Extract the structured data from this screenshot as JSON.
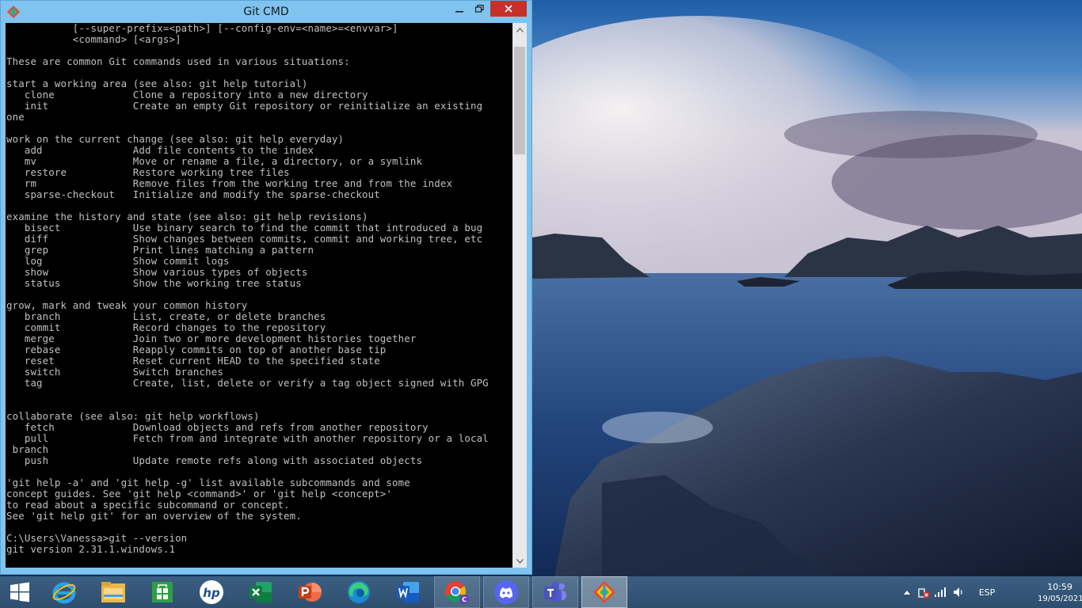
{
  "window": {
    "title": "Git CMD",
    "console_lines": [
      "           [--super-prefix=<path>] [--config-env=<name>=<envvar>]",
      "           <command> [<args>]",
      "",
      "These are common Git commands used in various situations:",
      "",
      "start a working area (see also: git help tutorial)",
      "   clone             Clone a repository into a new directory",
      "   init              Create an empty Git repository or reinitialize an existing",
      "one",
      "",
      "work on the current change (see also: git help everyday)",
      "   add               Add file contents to the index",
      "   mv                Move or rename a file, a directory, or a symlink",
      "   restore           Restore working tree files",
      "   rm                Remove files from the working tree and from the index",
      "   sparse-checkout   Initialize and modify the sparse-checkout",
      "",
      "examine the history and state (see also: git help revisions)",
      "   bisect            Use binary search to find the commit that introduced a bug",
      "   diff              Show changes between commits, commit and working tree, etc",
      "   grep              Print lines matching a pattern",
      "   log               Show commit logs",
      "   show              Show various types of objects",
      "   status            Show the working tree status",
      "",
      "grow, mark and tweak your common history",
      "   branch            List, create, or delete branches",
      "   commit            Record changes to the repository",
      "   merge             Join two or more development histories together",
      "   rebase            Reapply commits on top of another base tip",
      "   reset             Reset current HEAD to the specified state",
      "   switch            Switch branches",
      "   tag               Create, list, delete or verify a tag object signed with GPG",
      "",
      "",
      "collaborate (see also: git help workflows)",
      "   fetch             Download objects and refs from another repository",
      "   pull              Fetch from and integrate with another repository or a local",
      " branch",
      "   push              Update remote refs along with associated objects",
      "",
      "'git help -a' and 'git help -g' list available subcommands and some",
      "concept guides. See 'git help <command>' or 'git help <concept>'",
      "to read about a specific subcommand or concept.",
      "See 'git help git' for an overview of the system.",
      "",
      "C:\\Users\\Vanessa>git --version",
      "git version 2.31.1.windows.1"
    ]
  },
  "taskbar": {
    "items": [
      {
        "icon": "windows-start-icon",
        "open": false
      },
      {
        "icon": "internet-explorer-icon",
        "open": false
      },
      {
        "icon": "file-explorer-icon",
        "open": false
      },
      {
        "icon": "microsoft-store-icon",
        "open": false
      },
      {
        "icon": "hp-icon",
        "open": false
      },
      {
        "icon": "excel-icon",
        "open": false
      },
      {
        "icon": "powerpoint-icon",
        "open": false
      },
      {
        "icon": "edge-icon",
        "open": false
      },
      {
        "icon": "word-icon",
        "open": false
      },
      {
        "icon": "chrome-icon",
        "open": true
      },
      {
        "icon": "discord-icon",
        "open": true
      },
      {
        "icon": "teams-icon",
        "open": true
      },
      {
        "icon": "git-icon",
        "open": true,
        "active": true
      }
    ],
    "tray": {
      "language": "ESP",
      "time": "10:59",
      "date": "19/05/2021"
    }
  }
}
